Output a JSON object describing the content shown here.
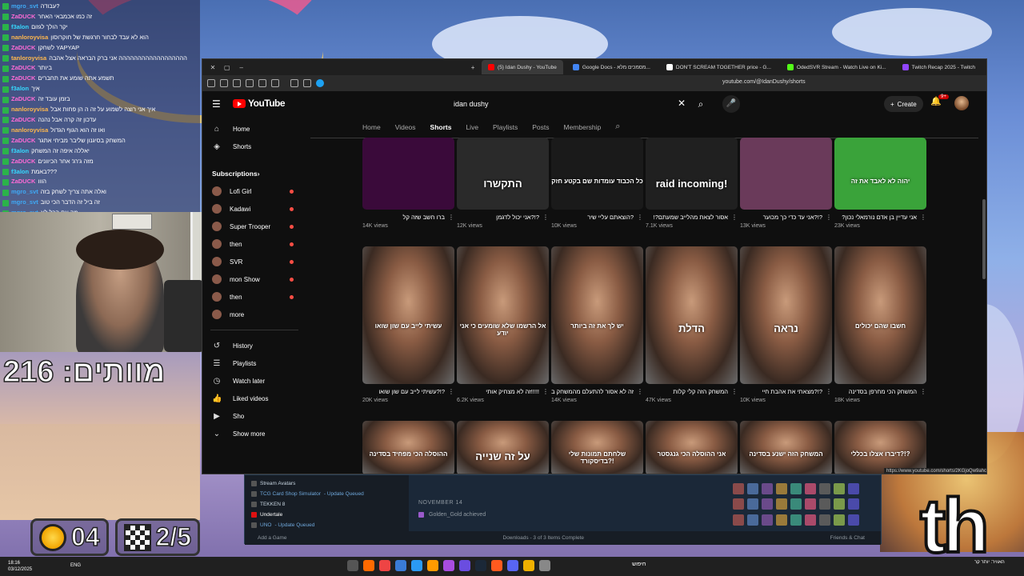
{
  "chat": {
    "lines": [
      {
        "user": "mgro_svt",
        "color": "#3fa9f5",
        "msg": "עבודה?"
      },
      {
        "user": "ZaDUCK",
        "color": "#ff6bd6",
        "msg": "זה כמו אכמבאי האחר"
      },
      {
        "user": "f3alon",
        "color": "#36d9ff",
        "msg": "יקר הולך לגזום"
      },
      {
        "user": "nanloroyvisa",
        "color": "#ffb84d",
        "msg": "הוא לא עבד לבחור חרגשת של חוקרוסון"
      },
      {
        "user": "ZaDUCK",
        "color": "#ff6bd6",
        "msg": "לשחקן YAPYAP"
      },
      {
        "user": "tanloroyvisa",
        "color": "#ffb84d",
        "msg": "הההההההההההההההההה אני ברק הבראה אצל אהבה"
      },
      {
        "user": "ZaDUCK",
        "color": "#ff6bd6",
        "msg": "ביותר"
      },
      {
        "user": "ZaDUCK",
        "color": "#ff6bd6",
        "msg": "תשמע אתה שומע את תחברים"
      },
      {
        "user": "f3alon",
        "color": "#36d9ff",
        "msg": "איך"
      },
      {
        "user": "ZaDUCK",
        "color": "#ff6bd6",
        "msg": "בזמן עובד זה"
      },
      {
        "user": "nanloroyvisa",
        "color": "#ffb84d",
        "msg": "איך אני רוצה לשמוע על זה ה הן פחות אבל"
      },
      {
        "user": "ZaDUCK",
        "color": "#ff6bd6",
        "msg": "עדכון זה קרה אבל נהנה"
      },
      {
        "user": "nanloroyvisa",
        "color": "#ffb84d",
        "msg": "ואו זה הוא הגוף הגדול"
      },
      {
        "user": "ZaDUCK",
        "color": "#ff6bd6",
        "msg": "המשחק בסיגנון שליבר מביחי אתגר"
      },
      {
        "user": "f3alon",
        "color": "#36d9ff",
        "msg": "יאללה איפה זה המשחק"
      },
      {
        "user": "ZaDUCK",
        "color": "#ff6bd6",
        "msg": "מזה ג'רג' אחר הכיוונים"
      },
      {
        "user": "f3alon",
        "color": "#36d9ff",
        "msg": "באמת???"
      },
      {
        "user": "ZaDUCK",
        "color": "#ff6bd6",
        "msg": "הווו"
      },
      {
        "user": "mgro_svt",
        "color": "#3fa9f5",
        "msg": "ואלה אתה צריך לשחק בזה"
      },
      {
        "user": "mgro_svt",
        "color": "#3fa9f5",
        "msg": "זה ביל זה הדבר הכי טוב"
      },
      {
        "user": "mgro_svt",
        "color": "#3fa9f5",
        "msg": "מה עם הכל לא"
      }
    ]
  },
  "overlay": {
    "viewers_label": "מוותים: 216",
    "coins": "04",
    "progress": "2/5"
  },
  "browser": {
    "tabs": [
      {
        "label": "(5) Idan Dushy - YouTube",
        "fav_color": "#ff0000",
        "active": true
      },
      {
        "label": "Google Docs - מסמכים מלא...",
        "fav_color": "#4285f4",
        "active": false
      },
      {
        "label": "DON'T SCREAM TOGETHER price - G...",
        "fav_color": "#ffffff",
        "active": false
      },
      {
        "label": "OdedSVR Stream - Watch Live on Ki...",
        "fav_color": "#53fc18",
        "active": false
      },
      {
        "label": "Twitch Recap 2025 - Twitch",
        "fav_color": "#9146ff",
        "active": false
      }
    ],
    "url": "youtube.com/@IdanDushy/shorts"
  },
  "youtube": {
    "logo": "YouTube",
    "search_value": "idan dushy",
    "create_label": "Create",
    "notif_count": "9+",
    "channel_tabs": [
      "Home",
      "Videos",
      "Shorts",
      "Live",
      "Playlists",
      "Posts",
      "Membership"
    ],
    "active_tab": "Shorts",
    "sidebar": {
      "top": [
        {
          "icon": "home-icon",
          "label": "Home"
        },
        {
          "icon": "shorts-icon",
          "label": "Shorts"
        }
      ],
      "subs_heading": "Subscriptions",
      "subs": [
        {
          "label": "Lofi Girl"
        },
        {
          "label": "Kadawi"
        },
        {
          "label": "Super Trooper"
        },
        {
          "label": "then"
        },
        {
          "label": "SVR"
        },
        {
          "label": "mon Show"
        },
        {
          "label": "then"
        },
        {
          "label": "more"
        }
      ],
      "you": [
        {
          "icon": "history-icon",
          "label": "History"
        },
        {
          "icon": "playlists-icon",
          "label": "Playlists"
        },
        {
          "icon": "watch-later-icon",
          "label": "Watch later"
        },
        {
          "icon": "liked-icon",
          "label": "Liked videos"
        },
        {
          "icon": "video-icon",
          "label": "Sho"
        },
        {
          "icon": "chevron-down-icon",
          "label": "Show more"
        }
      ]
    },
    "shorts_row1": [
      {
        "title": "ברו חשב שזה קל",
        "views": "14K views",
        "thumb_text": "",
        "bg": "#3a0a3a"
      },
      {
        "title": "?!?אני יכול לדגמן",
        "views": "12K views",
        "thumb_text": "התקשרו",
        "bg": "#2a2a2a"
      },
      {
        "title": "?הוצאתם עליי שיר",
        "views": "10K views",
        "thumb_text": "כל הכבוד עומדות שם בקטע חזק",
        "bg": "#1a1a1a"
      },
      {
        "title": "אסור לצאת מהלייב שמעתם?!",
        "views": "7.1K views",
        "thumb_text": "raid incoming!",
        "bg": "#202020"
      },
      {
        "title": "?!?אני עד כדי כך מכוער",
        "views": "13K views",
        "thumb_text": "",
        "bg": "#6a3a5a"
      },
      {
        "title": "אני עדיין בן אדם נורמאלי נכון?",
        "views": "23K views",
        "thumb_text": "יהוה לא לאבד את זה",
        "bg": "#3aa33a"
      }
    ],
    "shorts_row2": [
      {
        "title": "?!?עשיתי לייב עם שון שואו",
        "views": "20K views",
        "thumb_text": "עשיתי לייב עם שון שואו",
        "bg": "face"
      },
      {
        "title": "!!!!!זה לא מצחיק אותי",
        "views": "6.2K views",
        "thumb_text": "אל הרשמו שלא שומעים כי אני יודע",
        "bg": "face"
      },
      {
        "title": "זה לא אסור להתעלם מהמשחק בסדינה!",
        "views": "14K views",
        "thumb_text": "יש לך את זה ביותר",
        "bg": "face"
      },
      {
        "title": "המשחק הזה קלי קלות",
        "views": "47K views",
        "thumb_text": "הדלת",
        "bg": "face"
      },
      {
        "title": "?!?מצאתי את אהבת חיי",
        "views": "10K views",
        "thumb_text": "נראה",
        "bg": "face"
      },
      {
        "title": "המשחק הכי מחרפן בסדינה",
        "views": "18K views",
        "thumb_text": "חשבו שהם יכולים",
        "bg": "face"
      }
    ],
    "shorts_row3": [
      {
        "thumb_text": "ההוסלה הכי מפחיד בסדינה"
      },
      {
        "thumb_text": "על זה שנייה"
      },
      {
        "thumb_text": "שלחתם תמונות שלי בדיסקורד?!"
      },
      {
        "thumb_text": "אני ההוסלה הכי גנגסטר"
      },
      {
        "thumb_text": "המשחק הזה ישנע בסדינה"
      },
      {
        "thumb_text": "דיברו אצלו בכללי?!?"
      }
    ],
    "hover_url": "https://www.youtube.com/shorts/2KGjoQw9ahc"
  },
  "steam": {
    "games": [
      {
        "label": "Stream Avatars",
        "status": ""
      },
      {
        "label": "TCG Card Shop Simulator",
        "status": " - Update Queued"
      },
      {
        "label": "TEKKEN 8",
        "status": ""
      },
      {
        "label": "Undertale",
        "status": ""
      },
      {
        "label": "UNO",
        "status": " - Update Queued"
      }
    ],
    "date": "NOVEMBER 14",
    "achievement": "Golden_Gold achieved",
    "add_game": "Add a Game",
    "downloads": "Downloads - 3 of 3 Items Complete",
    "friends": "Friends & Chat"
  },
  "taskbar": {
    "time": "18:16",
    "date": "03/12/2025",
    "lang": "ENG",
    "search": "חיפוש",
    "notif": "האוויר: יותר קר"
  }
}
